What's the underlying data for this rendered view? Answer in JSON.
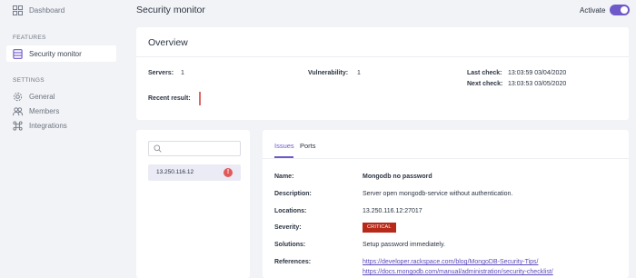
{
  "sidebar": {
    "dashboard": {
      "label": "Dashboard",
      "icon": "dashboard-icon"
    },
    "features_heading": "FEATURES",
    "security_monitor": {
      "label": "Security monitor",
      "icon": "server-icon"
    },
    "settings_heading": "SETTINGS",
    "general": {
      "label": "General",
      "icon": "gear-icon"
    },
    "members": {
      "label": "Members",
      "icon": "members-icon"
    },
    "integrations": {
      "label": "Integrations",
      "icon": "command-icon"
    }
  },
  "header": {
    "title": "Security monitor",
    "activate_label": "Activate",
    "activate_on": true
  },
  "overview": {
    "title": "Overview",
    "servers_label": "Servers:",
    "servers_value": "1",
    "vulnerability_label": "Vulnerability:",
    "vulnerability_value": "1",
    "last_check_label": "Last check:",
    "last_check_value": "13:03:59 03/04/2020",
    "next_check_label": "Next check:",
    "next_check_value": "13:03:53 03/05/2020",
    "recent_result_label": "Recent result:"
  },
  "server_list": {
    "search_placeholder": "",
    "items": [
      {
        "ip": "13.250.116.12",
        "alert": "!"
      }
    ]
  },
  "details": {
    "tabs": [
      {
        "label": "Issues",
        "active": true
      },
      {
        "label": "Ports",
        "active": false
      }
    ],
    "name_label": "Name:",
    "name_value": "Mongodb no password",
    "description_label": "Description:",
    "description_value": "Server open mongodb-service without authentication.",
    "locations_label": "Locations:",
    "locations_value": "13.250.116.12:27017",
    "severity_label": "Severity:",
    "severity_value": "CRITICAL",
    "solutions_label": "Solutions:",
    "solutions_value": "Setup password immediately.",
    "references_label": "References:",
    "references": [
      "https://developer.rackspace.com/blog/MongoDB-Security-Tips/",
      "https://docs.mongodb.com/manual/administration/security-checklist/"
    ]
  },
  "colors": {
    "accent": "#6f58c9",
    "critical": "#b72a1a",
    "alert": "#e05a5a",
    "background": "#f2f3f6"
  }
}
